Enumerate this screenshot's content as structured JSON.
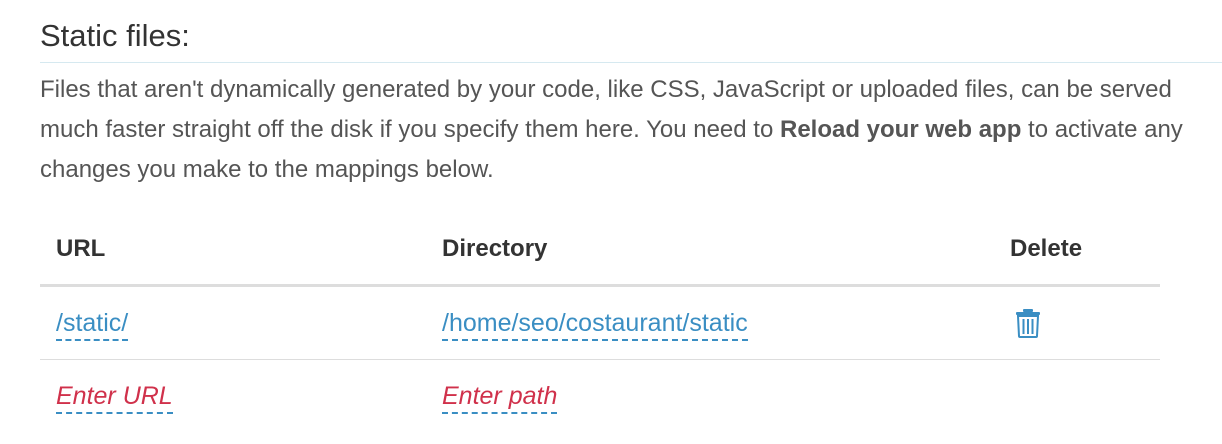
{
  "section": {
    "title": "Static files:",
    "description_part1": "Files that aren't dynamically generated by your code, like CSS, JavaScript or uploaded files, can be served much faster straight off the disk if you specify them here. You need to ",
    "description_bold": "Reload your web app",
    "description_part2": " to activate any changes you make to the mappings below."
  },
  "table": {
    "headers": {
      "url": "URL",
      "directory": "Directory",
      "delete": "Delete"
    },
    "rows": [
      {
        "url": "/static/",
        "directory": "/home/seo/costaurant/static",
        "delete_icon": "trash-icon"
      }
    ],
    "new_row": {
      "url_placeholder": "Enter URL",
      "path_placeholder": "Enter path"
    }
  },
  "colors": {
    "link": "#3a8ec3",
    "placeholder": "#d0314b",
    "rule": "#d6e9f0"
  }
}
